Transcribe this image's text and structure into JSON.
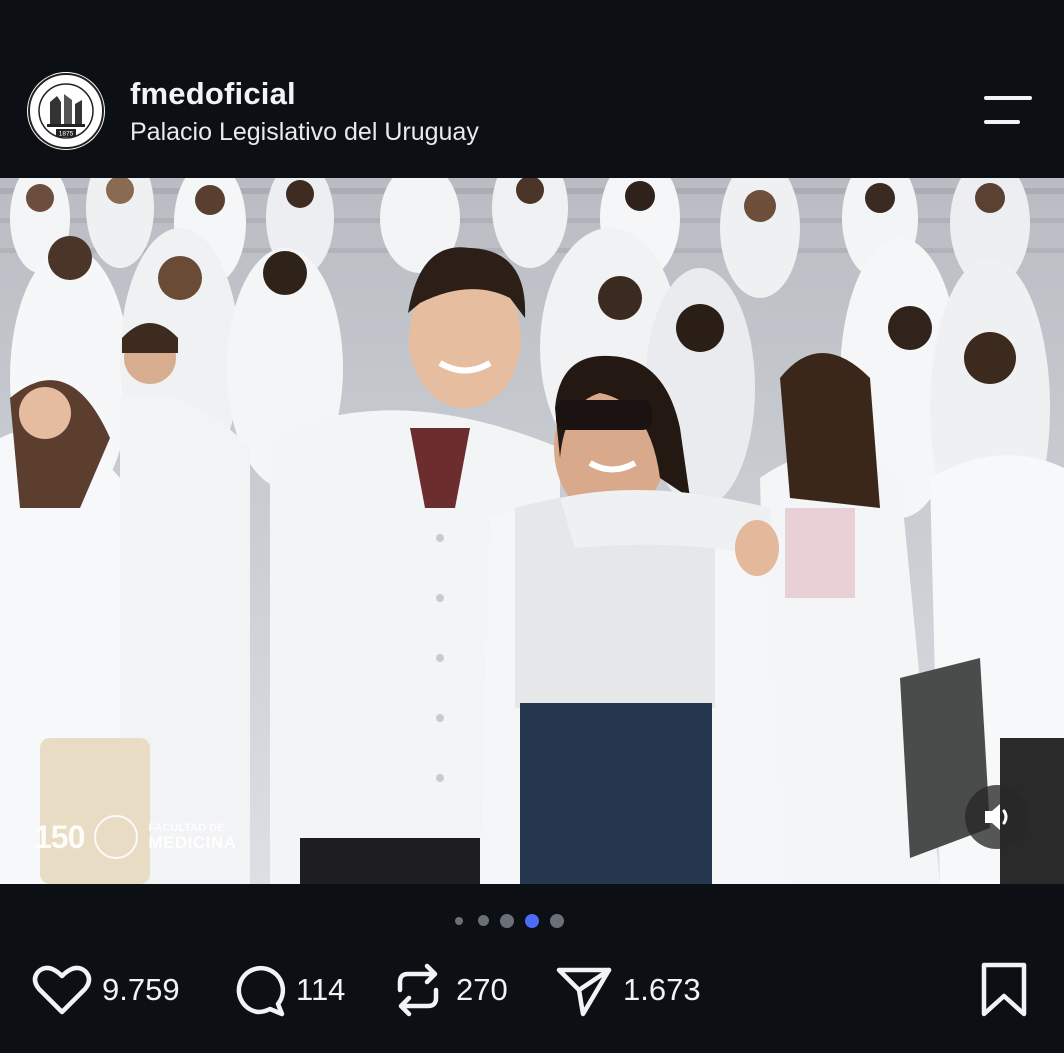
{
  "post": {
    "username": "fmedoficial",
    "location": "Palacio Legislativo del Uruguay",
    "avatar_year": "1875",
    "avatar_icon": "faculty-seal-icon"
  },
  "image": {
    "watermark_number": "150",
    "watermark_line1": "FACULTAD DE",
    "watermark_line2": "MEDICINA",
    "sound_icon": "speaker-icon"
  },
  "carousel": {
    "count": 5,
    "active_index": 3
  },
  "actions": {
    "likes": "9.759",
    "comments": "114",
    "reposts": "270",
    "shares": "1.673"
  },
  "colors": {
    "background": "#0c0f14",
    "active_dot": "#4a6cf7",
    "inactive_dot": "#6b6f78",
    "text": "#f2f3f5"
  }
}
